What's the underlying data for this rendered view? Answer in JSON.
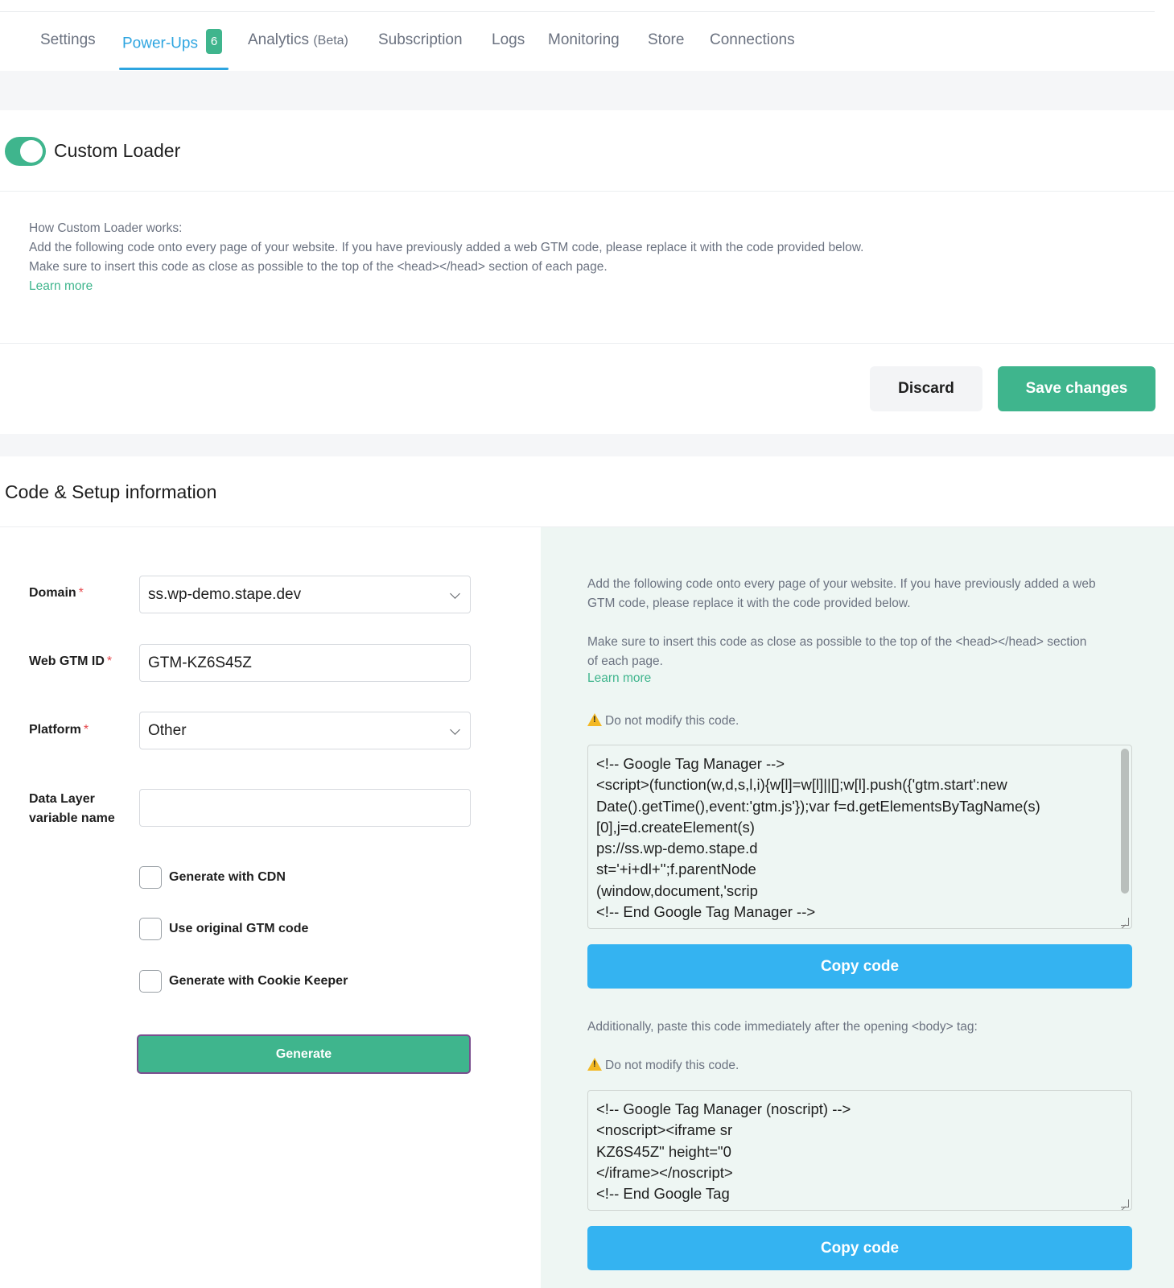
{
  "tabs": [
    {
      "label": "Settings"
    },
    {
      "label": "Power-Ups",
      "badge": "6"
    },
    {
      "label": "Analytics",
      "sub": "(Beta)"
    },
    {
      "label": "Subscription"
    },
    {
      "label": "Logs"
    },
    {
      "label": "Monitoring"
    },
    {
      "label": "Store"
    },
    {
      "label": "Connections"
    }
  ],
  "colors": {
    "accent": "#2ea5e0",
    "green": "#3fb58d",
    "copy_blue": "#34b3f1"
  },
  "powerup": {
    "title": "Custom Loader",
    "enabled": true,
    "info": {
      "line1": "How Custom Loader works:",
      "line2": "Add the following code onto every page of your website. If you have previously added a web GTM code, please replace it with the code provided below.",
      "line3": "Make sure to insert this code as close as possible to the top of the <head></head> section of each page.",
      "learn_more": "Learn more"
    },
    "discard_label": "Discard",
    "save_label": "Save changes"
  },
  "setup": {
    "title": "Code & Setup information",
    "form": {
      "domain_label": "Domain",
      "domain_value": "ss.wp-demo.stape.dev",
      "gtm_label": "Web GTM ID",
      "gtm_value": "GTM-KZ6S45Z",
      "platform_label": "Platform",
      "platform_value": "Other",
      "datalayer_label_1": "Data Layer",
      "datalayer_label_2": "variable name",
      "datalayer_value": "",
      "required_mark": "*",
      "cdn_label": "Generate with CDN",
      "original_label": "Use original GTM code",
      "cookie_label": "Generate with Cookie Keeper",
      "generate_label": "Generate"
    },
    "panel": {
      "intro1": "Add the following code onto every page of your website. If you have previously added a web",
      "intro2": "GTM code, please replace it with the code provided below.",
      "intro3": "Make sure to insert this code as close as possible to the top of the <head></head> section",
      "intro4": "of each page.",
      "learn_more": "Learn more",
      "warning": "Do not modify this code.",
      "head_code": [
        "<!-- Google Tag Manager -->",
        "<script>(function(w,d,s,l,i){w[l]=w[l]||[];w[l].push({'gtm.start':new",
        "Date().getTime(),event:'gtm.js'});var f=d.getElementsByTagName(s)",
        "[0],j=d.createElement(s)",
        "ps://ss.wp-demo.stape.d",
        "st='+i+dl+'';f.parentNode",
        "(window,document,'scrip",
        "<!-- End Google Tag Manager -->"
      ],
      "copy_label": "Copy code",
      "body_intro": "Additionally, paste this code immediately after the opening <body> tag:",
      "body_code": [
        "<!-- Google Tag Manager (noscript) -->",
        "<noscript><iframe sr",
        "KZ6S45Z\" height=\"0",
        "</iframe></noscript>",
        "<!-- End Google Tag"
      ]
    }
  }
}
